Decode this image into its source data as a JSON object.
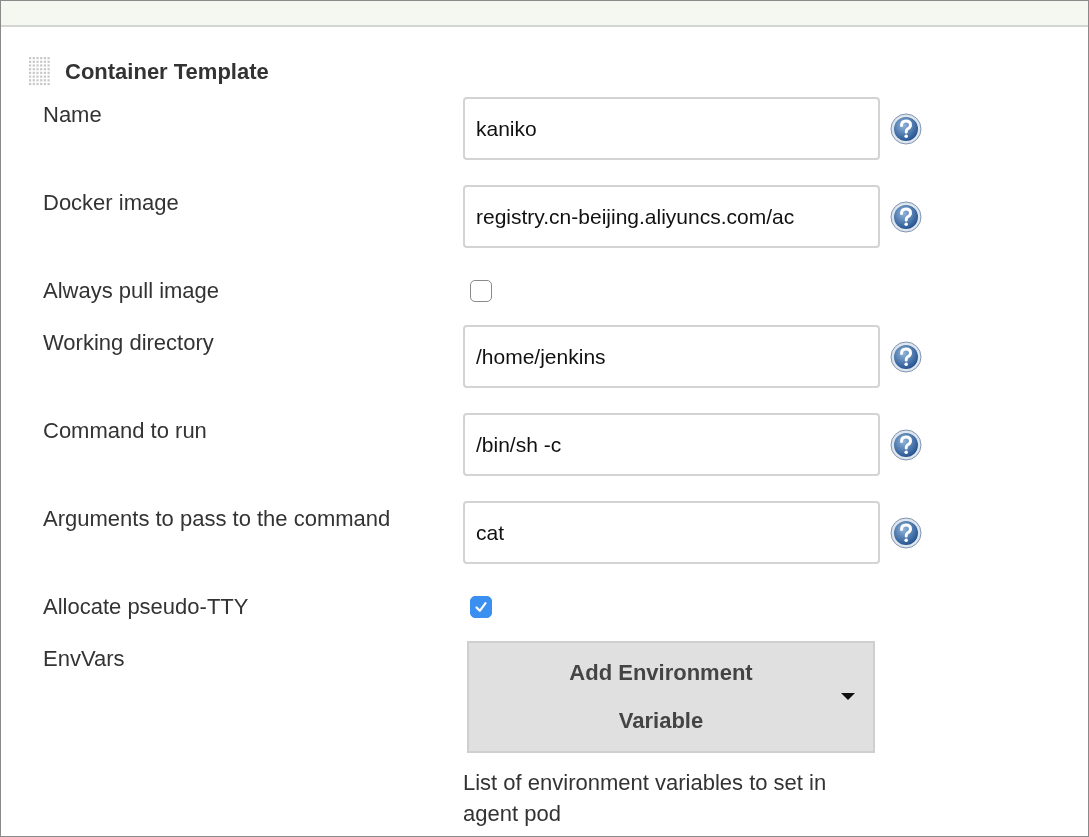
{
  "section": {
    "title": "Container Template"
  },
  "fields": [
    {
      "kind": "text",
      "label": "Name",
      "value": "kaniko"
    },
    {
      "kind": "text",
      "label": "Docker image",
      "value": "registry.cn-beijing.aliyuncs.com/ac"
    },
    {
      "kind": "checkbox",
      "label": "Always pull image",
      "checked": false
    },
    {
      "kind": "text",
      "label": "Working directory",
      "value": "/home/jenkins"
    },
    {
      "kind": "text",
      "label": "Command to run",
      "value": "/bin/sh -c"
    },
    {
      "kind": "text",
      "label": "Arguments to pass to the command",
      "value": "cat"
    },
    {
      "kind": "checkbox",
      "label": "Allocate pseudo-TTY",
      "checked": true
    },
    {
      "kind": "dropdown-button",
      "label": "EnvVars",
      "button": "Add Environment Variable",
      "description": "List of environment variables to set in agent pod"
    }
  ]
}
